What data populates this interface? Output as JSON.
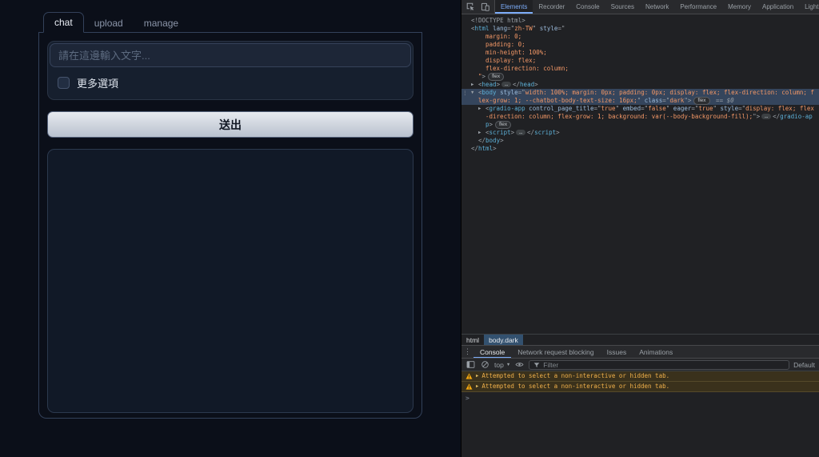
{
  "app": {
    "tabs": [
      {
        "label": "chat",
        "active": true
      },
      {
        "label": "upload",
        "active": false
      },
      {
        "label": "manage",
        "active": false
      }
    ],
    "textbox": {
      "value": "",
      "placeholder": "請在這邊輸入文字..."
    },
    "checkbox": {
      "label": "更多選項",
      "checked": false
    },
    "submit_button_label": "送出"
  },
  "devtools": {
    "toolbar_tabs": [
      {
        "label": "Elements",
        "active": true
      },
      {
        "label": "Recorder",
        "active": false
      },
      {
        "label": "Console",
        "active": false
      },
      {
        "label": "Sources",
        "active": false
      },
      {
        "label": "Network",
        "active": false
      },
      {
        "label": "Performance",
        "active": false
      },
      {
        "label": "Memory",
        "active": false
      },
      {
        "label": "Application",
        "active": false
      },
      {
        "label": "Lighthouse",
        "active": false
      }
    ],
    "dom_tree": [
      {
        "indent": 0,
        "arrow": null,
        "selected": false,
        "tokens": [
          [
            "g",
            "<!DOCTYPE html>"
          ]
        ]
      },
      {
        "indent": 0,
        "arrow": null,
        "selected": false,
        "tokens": [
          [
            "g",
            "<"
          ],
          [
            "t",
            "html"
          ],
          [
            "a",
            " lang"
          ],
          [
            "g",
            "=\""
          ],
          [
            "v",
            "zh-TW"
          ],
          [
            "g",
            "\""
          ],
          [
            "a",
            " style"
          ],
          [
            "g",
            "=\""
          ]
        ]
      },
      {
        "indent": 2,
        "arrow": null,
        "selected": false,
        "tokens": [
          [
            "v",
            "margin: 0;"
          ]
        ]
      },
      {
        "indent": 2,
        "arrow": null,
        "selected": false,
        "tokens": [
          [
            "v",
            "padding: 0;"
          ]
        ]
      },
      {
        "indent": 2,
        "arrow": null,
        "selected": false,
        "tokens": [
          [
            "v",
            "min-height: 100%;"
          ]
        ]
      },
      {
        "indent": 2,
        "arrow": null,
        "selected": false,
        "tokens": [
          [
            "v",
            "display: flex;"
          ]
        ]
      },
      {
        "indent": 2,
        "arrow": null,
        "selected": false,
        "tokens": [
          [
            "v",
            "flex-direction: column;"
          ]
        ]
      },
      {
        "indent": 1,
        "arrow": null,
        "selected": false,
        "tokens": [
          [
            "v",
            "\""
          ],
          [
            "g",
            ">"
          ],
          [
            "badge",
            "flex"
          ]
        ]
      },
      {
        "indent": 1,
        "arrow": "r",
        "selected": false,
        "tokens": [
          [
            "g",
            "<"
          ],
          [
            "t",
            "head"
          ],
          [
            "g",
            ">"
          ],
          [
            "ell",
            "…"
          ],
          [
            "g",
            "</"
          ],
          [
            "t",
            "head"
          ],
          [
            "g",
            ">"
          ]
        ]
      },
      {
        "indent": 1,
        "arrow": "d",
        "selected": true,
        "tokens": [
          [
            "g",
            "<"
          ],
          [
            "t",
            "body"
          ],
          [
            "a",
            " style"
          ],
          [
            "g",
            "=\""
          ],
          [
            "v",
            "width: 100%; margin: 0px; padding: 0px; display: flex; flex-direction: column; flex-grow: 1; --chatbot-body-text-size: 16px;"
          ],
          [
            "g",
            "\""
          ],
          [
            "a",
            " class"
          ],
          [
            "g",
            "=\""
          ],
          [
            "v",
            "dark"
          ],
          [
            "g",
            "\""
          ],
          [
            "g",
            ">"
          ],
          [
            "badge",
            "flex"
          ],
          [
            "eq",
            " == $0"
          ]
        ]
      },
      {
        "indent": 2,
        "arrow": "r",
        "selected": false,
        "tokens": [
          [
            "g",
            "<"
          ],
          [
            "t",
            "gradio-app"
          ],
          [
            "a",
            " control_page_title"
          ],
          [
            "g",
            "=\""
          ],
          [
            "v",
            "true"
          ],
          [
            "g",
            "\""
          ],
          [
            "a",
            " embed"
          ],
          [
            "g",
            "=\""
          ],
          [
            "v",
            "false"
          ],
          [
            "g",
            "\""
          ],
          [
            "a",
            " eager"
          ],
          [
            "g",
            "=\""
          ],
          [
            "v",
            "true"
          ],
          [
            "g",
            "\""
          ],
          [
            "a",
            " style"
          ],
          [
            "g",
            "=\""
          ],
          [
            "v",
            "display: flex; flex-direction: column; flex-grow: 1; background: var(--body-background-fill);"
          ],
          [
            "g",
            "\""
          ],
          [
            "g",
            ">"
          ],
          [
            "ell",
            "…"
          ],
          [
            "g",
            "</"
          ],
          [
            "t",
            "gradio-app"
          ],
          [
            "g",
            ">"
          ],
          [
            "badge",
            "flex"
          ]
        ]
      },
      {
        "indent": 2,
        "arrow": "r",
        "selected": false,
        "tokens": [
          [
            "g",
            "<"
          ],
          [
            "t",
            "script"
          ],
          [
            "g",
            ">"
          ],
          [
            "ell",
            "…"
          ],
          [
            "g",
            "</"
          ],
          [
            "t",
            "script"
          ],
          [
            "g",
            ">"
          ]
        ]
      },
      {
        "indent": 1,
        "arrow": null,
        "selected": false,
        "tokens": [
          [
            "g",
            "</"
          ],
          [
            "t",
            "body"
          ],
          [
            "g",
            ">"
          ]
        ]
      },
      {
        "indent": 0,
        "arrow": null,
        "selected": false,
        "tokens": [
          [
            "g",
            "</"
          ],
          [
            "t",
            "html"
          ],
          [
            "g",
            ">"
          ]
        ]
      }
    ],
    "breadcrumbs": [
      {
        "label": "html",
        "active": false
      },
      {
        "label": "body.dark",
        "active": true
      }
    ],
    "drawer_tabs": [
      {
        "label": "Console",
        "active": true
      },
      {
        "label": "Network request blocking",
        "active": false
      },
      {
        "label": "Issues",
        "active": false
      },
      {
        "label": "Animations",
        "active": false
      }
    ],
    "console": {
      "frame_selector": "top",
      "filter_placeholder": "Filter",
      "levels_label": "Default",
      "prompt_symbol": ">",
      "messages": [
        {
          "type": "warning",
          "text": "Attempted to select a non-interactive or hidden tab."
        },
        {
          "type": "warning",
          "text": "Attempted to select a non-interactive or hidden tab."
        }
      ]
    }
  },
  "colors": {
    "accent_blue": "#7cacf8",
    "warning_text": "#f0b04a",
    "syntax_tag": "#5db0d7",
    "syntax_attr": "#9bbbdc",
    "syntax_value": "#f29766",
    "selection_bg": "#35455c"
  }
}
